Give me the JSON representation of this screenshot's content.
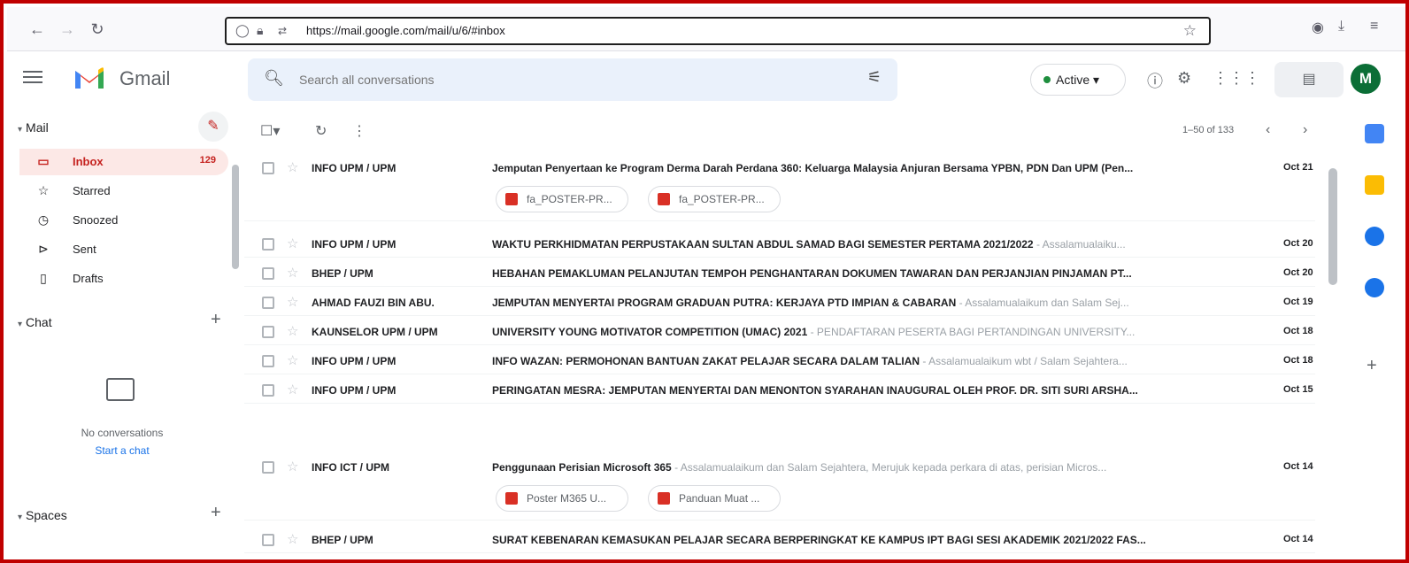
{
  "browser": {
    "url": "https://mail.google.com/mail/u/6/#inbox"
  },
  "header": {
    "app_name": "Gmail",
    "search_placeholder": "Search all conversations",
    "status_label": "Active",
    "avatar_initial": "M"
  },
  "sidebar": {
    "mail_heading": "Mail",
    "items": [
      {
        "label": "Inbox",
        "count": "129",
        "icon": "inbox-icon"
      },
      {
        "label": "Starred",
        "count": "",
        "icon": "star-icon"
      },
      {
        "label": "Snoozed",
        "count": "",
        "icon": "clock-icon"
      },
      {
        "label": "Sent",
        "count": "",
        "icon": "send-icon"
      },
      {
        "label": "Drafts",
        "count": "",
        "icon": "draft-icon"
      }
    ],
    "chat_heading": "Chat",
    "no_conversations": "No conversations",
    "start_chat": "Start a chat",
    "spaces_heading": "Spaces"
  },
  "toolbar": {
    "pager": "1–50 of 133"
  },
  "emails": [
    {
      "sender": "INFO UPM / UPM",
      "subject": "Jemputan Penyertaan ke Program Derma Darah Perdana 360: Keluarga Malaysia Anjuran Bersama YPBN, PDN Dan UPM (Pen...",
      "snippet": "",
      "date": "Oct 21",
      "attachments": [
        "fa_POSTER-PR...",
        "fa_POSTER-PR..."
      ]
    },
    {
      "sender": "INFO UPM / UPM",
      "subject": "WAKTU PERKHIDMATAN PERPUSTAKAAN SULTAN ABDUL SAMAD BAGI SEMESTER PERTAMA 2021/2022",
      "snippet": " - Assalamualaiku...",
      "date": "Oct 20",
      "attachments": []
    },
    {
      "sender": "BHEP / UPM",
      "subject": "HEBAHAN PEMAKLUMAN PELANJUTAN TEMPOH PENGHANTARAN DOKUMEN TAWARAN DAN PERJANJIAN PINJAMAN PT...",
      "snippet": "",
      "date": "Oct 20",
      "attachments": []
    },
    {
      "sender": "AHMAD FAUZI BIN ABU.",
      "subject": "JEMPUTAN MENYERTAI PROGRAM GRADUAN PUTRA: KERJAYA PTD IMPIAN & CABARAN",
      "snippet": " - Assalamualaikum dan Salam Sej...",
      "date": "Oct 19",
      "attachments": []
    },
    {
      "sender": "KAUNSELOR UPM / UPM",
      "subject": "UNIVERSITY YOUNG MOTIVATOR COMPETITION (UMAC) 2021",
      "snippet": " - PENDAFTARAN PESERTA BAGI PERTANDINGAN UNIVERSITY...",
      "date": "Oct 18",
      "attachments": []
    },
    {
      "sender": "INFO UPM / UPM",
      "subject": "INFO WAZAN: PERMOHONAN BANTUAN ZAKAT PELAJAR SECARA DALAM TALIAN",
      "snippet": " - Assalamualaikum wbt / Salam Sejahtera...",
      "date": "Oct 18",
      "attachments": []
    },
    {
      "sender": "INFO UPM / UPM",
      "subject": "PERINGATAN MESRA: JEMPUTAN MENYERTAI DAN MENONTON SYARAHAN INAUGURAL OLEH PROF. DR. SITI SURI ARSHA...",
      "snippet": "",
      "date": "Oct 15",
      "attachments": []
    },
    {
      "sender": "INFO ICT / UPM",
      "subject": "Penggunaan Perisian Microsoft 365",
      "snippet": " - Assalamualaikum dan Salam Sejahtera, Merujuk kepada perkara di atas, perisian Micros...",
      "date": "Oct 14",
      "attachments": [
        "Poster M365 U...",
        "Panduan Muat ..."
      ]
    },
    {
      "sender": "BHEP / UPM",
      "subject": "SURAT KEBENARAN KEMASUKAN PELAJAR SECARA BERPERINGKAT KE KAMPUS IPT BAGI SESI AKADEMIK 2021/2022 FAS...",
      "snippet": "",
      "date": "Oct 14",
      "attachments": []
    }
  ],
  "colors": {
    "accent_red": "#c5221f",
    "active_green": "#1e8e3e",
    "search_bg": "#eaf1fb",
    "inbox_highlight": "#fce8e6"
  }
}
